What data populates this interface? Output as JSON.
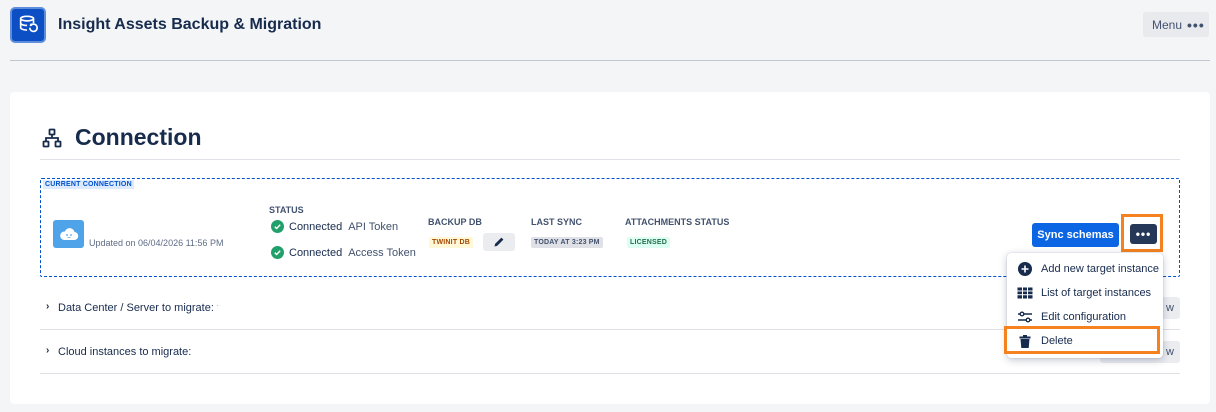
{
  "header": {
    "title": "Insight Assets Backup & Migration",
    "menu_label": "Menu",
    "menu_icon": "more-horizontal-icon"
  },
  "section": {
    "title": "Connection",
    "icon": "hierarchy-icon"
  },
  "connection": {
    "tag": "CURRENT CONNECTION",
    "updated": "Updated on 06/04/2026 11:56 PM",
    "status_label": "STATUS",
    "status_items": [
      {
        "value": "Connected",
        "type": "API Token"
      },
      {
        "value": "Connected",
        "type": "Access Token"
      }
    ],
    "backup_db_label": "BACKUP DB",
    "backup_db_value": "TWINIT DB",
    "last_sync_label": "LAST SYNC",
    "last_sync_value": "TODAY AT 3:23 PM",
    "attachments_label": "ATTACHMENTS STATUS",
    "attachments_value": "LICENSED",
    "sync_button": "Sync schemas"
  },
  "accordions": [
    {
      "label": "Data Center / Server to migrate:",
      "button": "w"
    },
    {
      "label": "Cloud instances to migrate:",
      "button": "w"
    }
  ],
  "dropdown": {
    "items": [
      {
        "label": "Add new target instance",
        "icon": "plus-circle-icon"
      },
      {
        "label": "List of target instances",
        "icon": "table-icon"
      },
      {
        "label": "Edit configuration",
        "icon": "sliders-icon"
      },
      {
        "label": "Delete",
        "icon": "trash-icon"
      }
    ]
  },
  "colors": {
    "accent": "#0c66e4",
    "highlight": "#f5821f",
    "success": "#22a06b"
  }
}
